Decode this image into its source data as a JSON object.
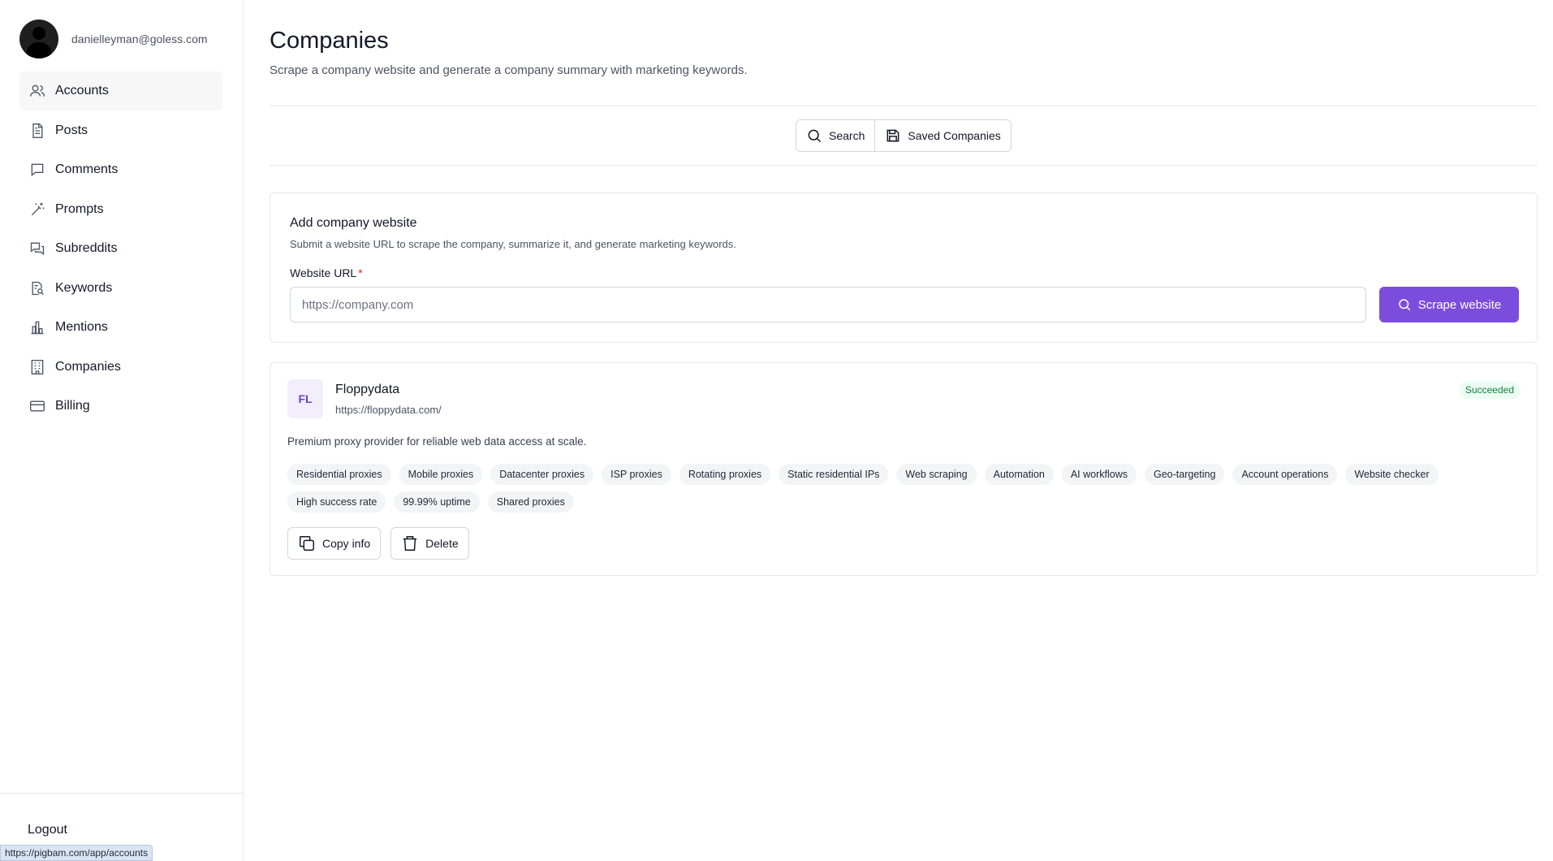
{
  "user": {
    "email": "danielleyman@goless.com"
  },
  "nav": {
    "items": [
      {
        "label": "Accounts",
        "icon": "user-icon"
      },
      {
        "label": "Posts",
        "icon": "document-icon"
      },
      {
        "label": "Comments",
        "icon": "message-icon"
      },
      {
        "label": "Prompts",
        "icon": "magic-wand-icon"
      },
      {
        "label": "Subreddits",
        "icon": "chat-bubbles-icon"
      },
      {
        "label": "Keywords",
        "icon": "document-search-icon"
      },
      {
        "label": "Mentions",
        "icon": "bar-chart-icon"
      },
      {
        "label": "Companies",
        "icon": "building-icon"
      },
      {
        "label": "Billing",
        "icon": "credit-card-icon"
      }
    ],
    "active": "Accounts"
  },
  "sidebar": {
    "logout_label": "Logout"
  },
  "status_bar": {
    "url": "https://pigbam.com/app/accounts"
  },
  "page": {
    "title": "Companies",
    "subtitle": "Scrape a company website and generate a company summary with marketing keywords."
  },
  "tabs": {
    "search_label": "Search",
    "saved_label": "Saved Companies"
  },
  "form": {
    "title": "Add company website",
    "description": "Submit a website URL to scrape the company, summarize it, and generate marketing keywords.",
    "url_label": "Website URL",
    "required_mark": "*",
    "url_placeholder": "https://company.com",
    "submit_label": "Scrape website"
  },
  "company": {
    "initials": "FL",
    "name": "Floppydata",
    "url": "https://floppydata.com/",
    "status": "Succeeded",
    "description": "Premium proxy provider for reliable web data access at scale.",
    "tags": [
      "Residential proxies",
      "Mobile proxies",
      "Datacenter proxies",
      "ISP proxies",
      "Rotating proxies",
      "Static residential IPs",
      "Web scraping",
      "Automation",
      "AI workflows",
      "Geo-targeting",
      "Account operations",
      "Website checker",
      "High success rate",
      "99.99% uptime",
      "Shared proxies"
    ],
    "copy_label": "Copy info",
    "delete_label": "Delete"
  },
  "colors": {
    "accent": "#7c4ddc",
    "success": "#15803d",
    "avatar_bg": "#f3eefc"
  }
}
